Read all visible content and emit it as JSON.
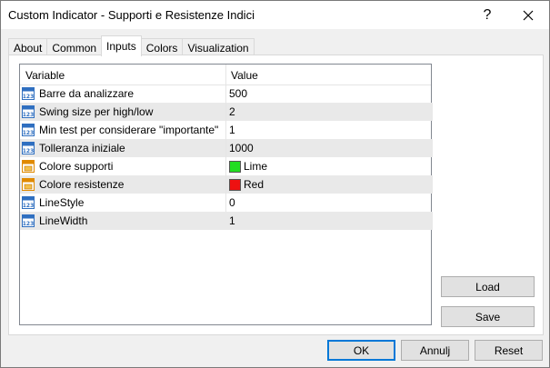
{
  "window": {
    "title": "Custom Indicator - Supporti e Resistenze Indici",
    "help_symbol": "?",
    "close_symbol": "✕"
  },
  "tabs": [
    {
      "label": "About",
      "active": false
    },
    {
      "label": "Common",
      "active": false
    },
    {
      "label": "Inputs",
      "active": true
    },
    {
      "label": "Colors",
      "active": false
    },
    {
      "label": "Visualization",
      "active": false
    }
  ],
  "grid": {
    "headers": {
      "variable": "Variable",
      "value": "Value"
    },
    "rows": [
      {
        "name": "Barre da analizzare",
        "value": "500",
        "icon": "number-icon"
      },
      {
        "name": "Swing size per high/low",
        "value": "2",
        "icon": "number-icon"
      },
      {
        "name": "Min test per considerare \"importante\"",
        "value": "1",
        "icon": "number-icon"
      },
      {
        "name": "Tolleranza iniziale",
        "value": "1000",
        "icon": "number-icon"
      },
      {
        "name": "Colore supporti",
        "value": "Lime",
        "icon": "color-icon",
        "swatch": "#22dd22"
      },
      {
        "name": "Colore resistenze",
        "value": "Red",
        "icon": "color-icon",
        "swatch": "#ee1111"
      },
      {
        "name": "LineStyle",
        "value": "0",
        "icon": "number-icon"
      },
      {
        "name": "LineWidth",
        "value": "1",
        "icon": "number-icon"
      }
    ]
  },
  "buttons": {
    "load": "Load",
    "save": "Save",
    "ok": "OK",
    "cancel": "Annulj",
    "reset": "Reset"
  },
  "colors": {
    "accent": "#0078d7",
    "number_icon": "#2f6fc0",
    "color_icon": "#e08a00"
  }
}
